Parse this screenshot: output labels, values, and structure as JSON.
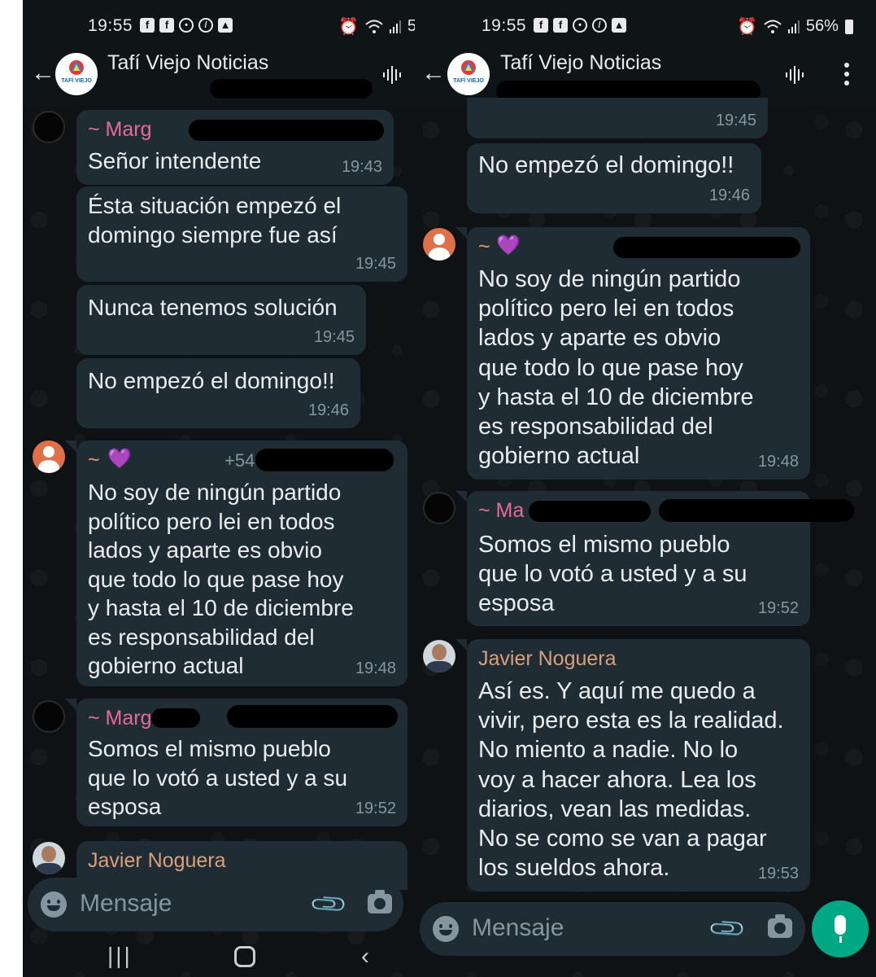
{
  "left": {
    "status": {
      "time": "19:55",
      "battery": "5("
    },
    "header": {
      "title": "Tafí Viejo Noticias",
      "logo_text": "TAFÍ VIEJO"
    },
    "messages": [
      {
        "sender": "~ Marg",
        "text": "Señor intendente",
        "time": "19:43"
      },
      {
        "text": "Ésta situación empezó el\ndomingo siempre fue así",
        "time": "19:45"
      },
      {
        "text": "Nunca tenemos solución",
        "time": "19:45"
      },
      {
        "text": "No empezó el domingo!!",
        "time": "19:46"
      },
      {
        "sender": "~",
        "phone": "+54",
        "text": "No soy de ningún partido\npolítico pero lei en todos\nlados y aparte es obvio\nque todo lo que pase hoy\ny hasta el 10 de diciembre\nes responsabilidad del\ngobierno actual",
        "time": "19:48"
      },
      {
        "sender": "~ Marg",
        "text": "Somos el mismo pueblo\nque lo votó a usted y a su\nesposa",
        "time": "19:52"
      },
      {
        "sender": "Javier Noguera"
      }
    ],
    "input": {
      "placeholder": "Mensaje"
    }
  },
  "right": {
    "status": {
      "time": "19:55",
      "battery": "56%"
    },
    "header": {
      "title": "Tafí Viejo Noticias",
      "logo_text": "TAFÍ VIEJO"
    },
    "messages": [
      {
        "time": "19:45"
      },
      {
        "text": "No empezó el domingo!!",
        "time": "19:46"
      },
      {
        "sender": "~",
        "text": "No soy de ningún partido\npolítico pero lei en todos\nlados y aparte es obvio\nque todo lo que pase hoy\ny hasta el 10 de diciembre\nes responsabilidad del\ngobierno actual",
        "time": "19:48"
      },
      {
        "sender": "~ Ma",
        "text": "Somos el mismo pueblo\nque lo votó a usted y a su\nesposa",
        "time": "19:52"
      },
      {
        "sender": "Javier Noguera",
        "text": "Así es. Y aquí me quedo a\nvivir, pero esta es la realidad.\nNo miento a nadie. No lo\nvoy a hacer ahora. Lea los\ndiarios, vean las medidas.\nNo se como se van a pagar\nlos sueldos ahora.",
        "time": "19:53"
      }
    ],
    "input": {
      "placeholder": "Mensaje"
    }
  },
  "colors": {
    "bubble": "#1f2c34",
    "sender_pink": "#e86a9a",
    "sender_orange": "#e0a070",
    "sender_tan": "#d9a07a",
    "timestamp": "#8696a0",
    "accent_green": "#00a884"
  }
}
